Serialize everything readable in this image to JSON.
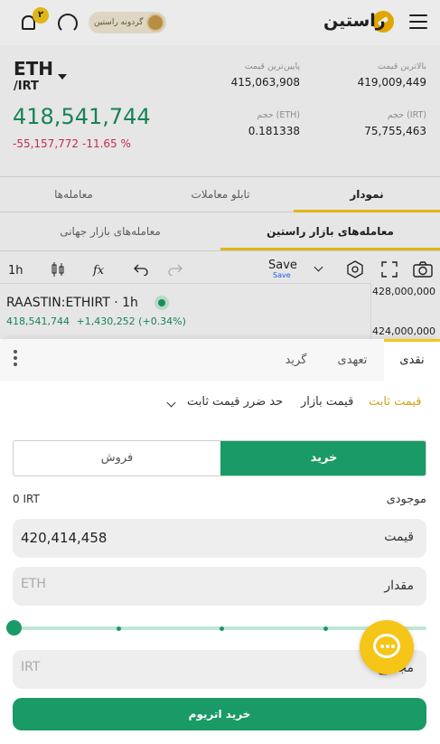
{
  "header": {
    "logo_text": "راستین",
    "wheel_label": "گردونه راستین",
    "notification_count": "۲"
  },
  "ticker": {
    "pair_base": "ETH",
    "pair_quote": "/IRT",
    "last_price": "418,541,744",
    "change_abs": "-55,157,772",
    "change_pct": "-11.65 %",
    "high_label": "بالاترین قیمت",
    "high_value": "419,009,449",
    "low_label": "پایین‌ترین قیمت",
    "low_value": "415,063,908",
    "vol_irt_label": "حجم (IRT)",
    "vol_irt_value": "75,755,463",
    "vol_eth_label": "حجم (ETH)",
    "vol_eth_value": "0.181338"
  },
  "main_tabs": [
    "نمودار",
    "تابلو معاملات",
    "معامله‌ها"
  ],
  "market_tabs": [
    "معامله‌های بازار راستین",
    "معامله‌های بازار جهانی"
  ],
  "chart_toolbar": {
    "interval": "1h",
    "save_label": "Save",
    "save_sub": "Save"
  },
  "chart": {
    "symbol_label": "RAASTIN:ETHIRT · 1h",
    "price": "418,541,744",
    "change": "+1,430,252 (+0.34%)",
    "axis_top": "428,000,000",
    "axis_bottom": "424,000,000"
  },
  "trade_sheet": {
    "tabs": [
      "نقدی",
      "تعهدی",
      "گرید"
    ],
    "order_types": [
      "قیمت ثابت",
      "قیمت بازار",
      "حد ضرر قیمت ثابت"
    ],
    "buy_label": "خرید",
    "sell_label": "فروش",
    "balance_label": "موجودی",
    "balance_value": "0 IRT",
    "price_label": "قیمت",
    "price_value": "420,414,458",
    "amount_label": "مقدار",
    "amount_placeholder": "ETH",
    "total_label": "مجموع",
    "total_placeholder": "IRT",
    "submit_label": "خرید اتریوم",
    "slider_percent": 0
  },
  "colors": {
    "accent": "#f5c518",
    "buy": "#1a9a66",
    "down": "#d8314c"
  }
}
